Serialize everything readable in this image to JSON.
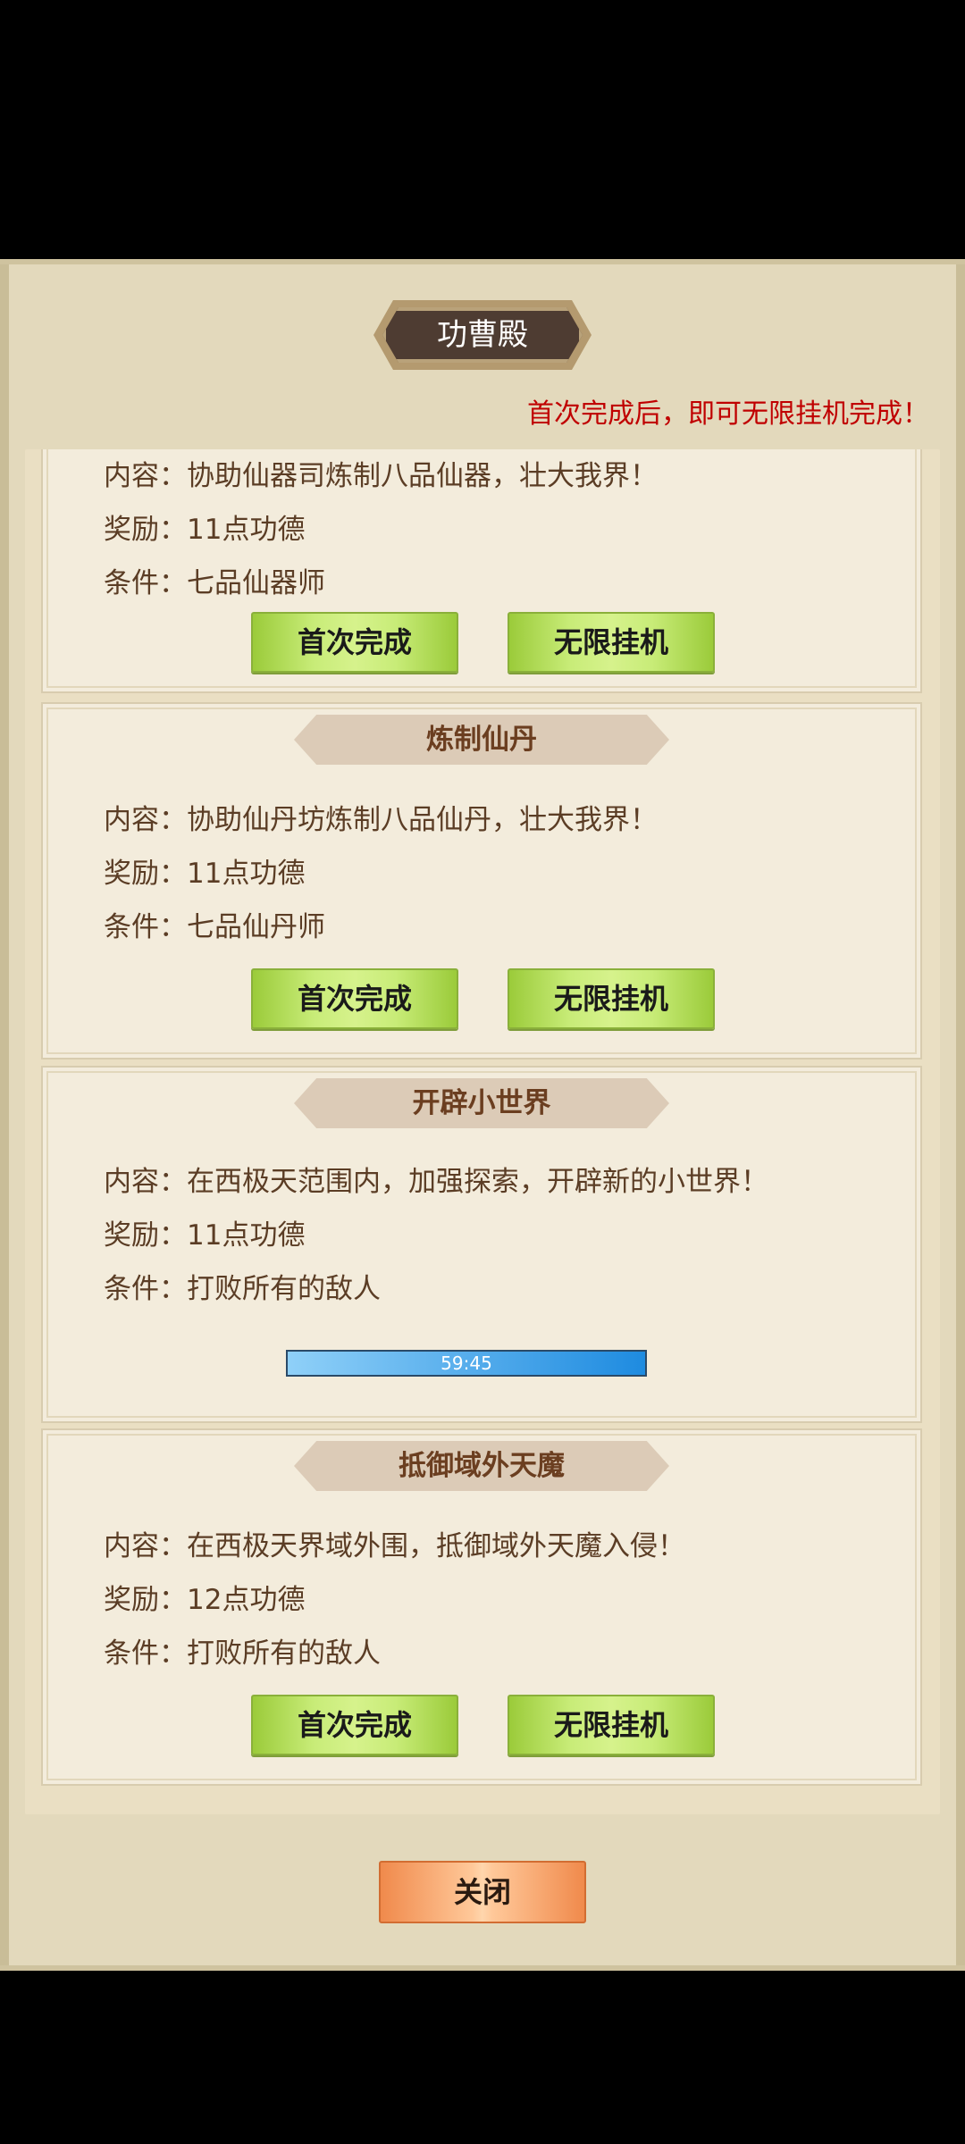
{
  "dialog": {
    "title": "功曹殿",
    "notice": "首次完成后，即可无限挂机完成！",
    "close_label": "关闭"
  },
  "tasks": [
    {
      "title": "",
      "content": "内容：协助仙器司炼制八品仙器，壮大我界！",
      "reward": "奖励：11点功德",
      "condition": "条件：七品仙器师",
      "first_label": "首次完成",
      "idle_label": "无限挂机"
    },
    {
      "title": "炼制仙丹",
      "content": "内容：协助仙丹坊炼制八品仙丹，壮大我界！",
      "reward": "奖励：11点功德",
      "condition": "条件：七品仙丹师",
      "first_label": "首次完成",
      "idle_label": "无限挂机"
    },
    {
      "title": "开辟小世界",
      "content": "内容：在西极天范围内，加强探索，开辟新的小世界！",
      "reward": "奖励：11点功德",
      "condition": "条件：打败所有的敌人",
      "timer": "59:45"
    },
    {
      "title": "抵御域外天魔",
      "content": "内容：在西极天界域外围，抵御域外天魔入侵！",
      "reward": "奖励：12点功德",
      "condition": "条件：打败所有的敌人",
      "first_label": "首次完成",
      "idle_label": "无限挂机"
    }
  ]
}
